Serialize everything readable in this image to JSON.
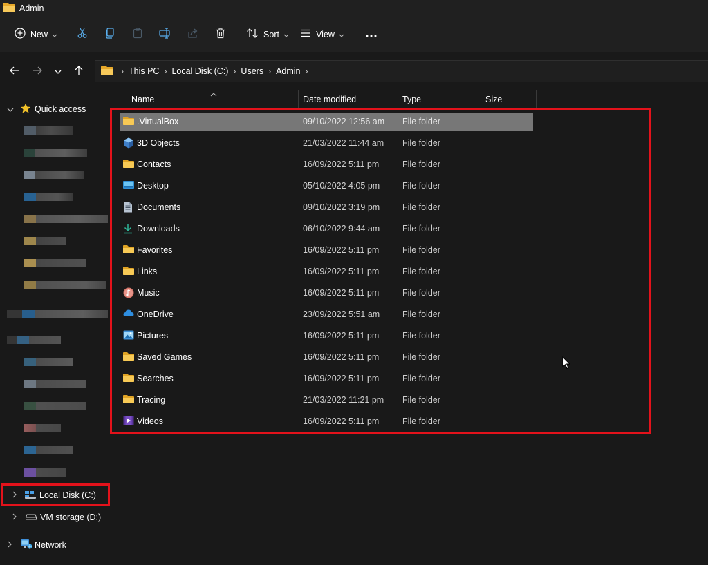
{
  "window": {
    "title": "Admin"
  },
  "toolbar": {
    "new_label": "New",
    "sort_label": "Sort",
    "view_label": "View"
  },
  "address": {
    "crumbs": [
      "This PC",
      "Local Disk (C:)",
      "Users",
      "Admin"
    ]
  },
  "sidebar": {
    "quick_access_label": "Quick access",
    "local_disk_label": "Local Disk (C:)",
    "vm_storage_label": "VM storage (D:)",
    "network_label": "Network"
  },
  "columns": {
    "name": "Name",
    "date": "Date modified",
    "type": "Type",
    "size": "Size"
  },
  "files": [
    {
      "name": ".VirtualBox",
      "date": "09/10/2022 12:56 am",
      "type": "File folder",
      "icon": "folder-icon"
    },
    {
      "name": "3D Objects",
      "date": "21/03/2022 11:44 am",
      "type": "File folder",
      "icon": "cube-3d-icon"
    },
    {
      "name": "Contacts",
      "date": "16/09/2022 5:11 pm",
      "type": "File folder",
      "icon": "folder-icon"
    },
    {
      "name": "Desktop",
      "date": "05/10/2022 4:05 pm",
      "type": "File folder",
      "icon": "desktop-icon"
    },
    {
      "name": "Documents",
      "date": "09/10/2022 3:19 pm",
      "type": "File folder",
      "icon": "document-icon"
    },
    {
      "name": "Downloads",
      "date": "06/10/2022 9:44 am",
      "type": "File folder",
      "icon": "download-icon"
    },
    {
      "name": "Favorites",
      "date": "16/09/2022 5:11 pm",
      "type": "File folder",
      "icon": "folder-icon"
    },
    {
      "name": "Links",
      "date": "16/09/2022 5:11 pm",
      "type": "File folder",
      "icon": "folder-icon"
    },
    {
      "name": "Music",
      "date": "16/09/2022 5:11 pm",
      "type": "File folder",
      "icon": "music-icon"
    },
    {
      "name": "OneDrive",
      "date": "23/09/2022 5:51 am",
      "type": "File folder",
      "icon": "cloud-icon"
    },
    {
      "name": "Pictures",
      "date": "16/09/2022 5:11 pm",
      "type": "File folder",
      "icon": "pictures-icon"
    },
    {
      "name": "Saved Games",
      "date": "16/09/2022 5:11 pm",
      "type": "File folder",
      "icon": "folder-icon"
    },
    {
      "name": "Searches",
      "date": "16/09/2022 5:11 pm",
      "type": "File folder",
      "icon": "folder-icon"
    },
    {
      "name": "Tracing",
      "date": "21/03/2022 11:21 pm",
      "type": "File folder",
      "icon": "folder-icon"
    },
    {
      "name": "Videos",
      "date": "16/09/2022 5:11 pm",
      "type": "File folder",
      "icon": "videos-icon"
    }
  ],
  "colors": {
    "background": "#191919",
    "toolbar": "#202020",
    "selection": "#777777",
    "highlight_annotation": "#e3121b",
    "folder_yellow": "#f4c34a"
  }
}
